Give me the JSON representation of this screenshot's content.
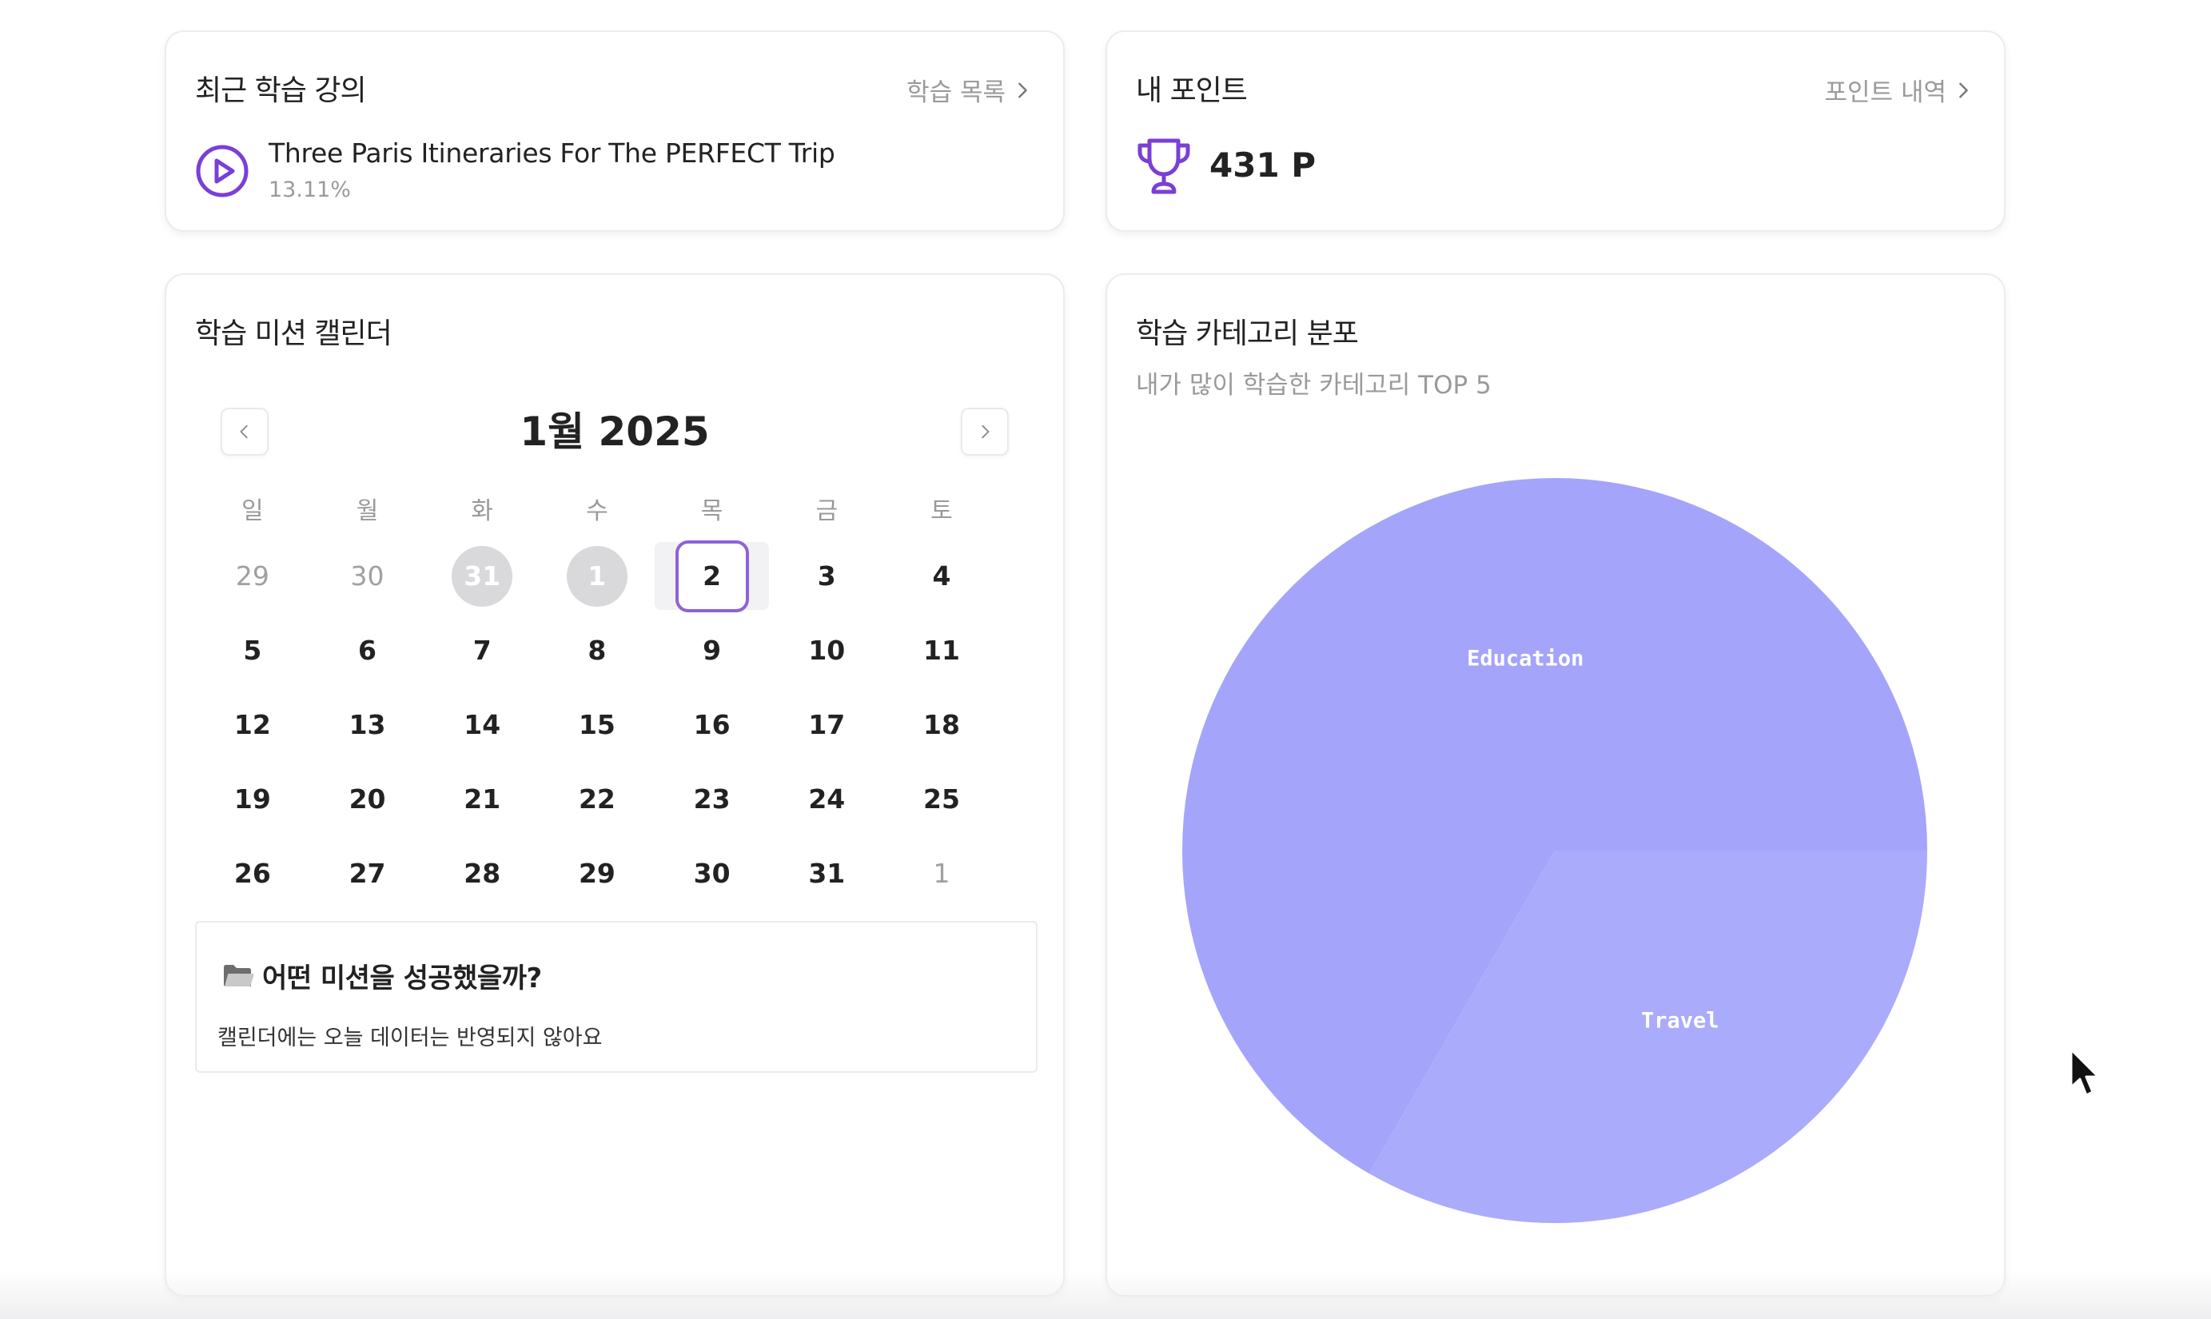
{
  "recent": {
    "title": "최근 학습 강의",
    "link_label": "학습 목록",
    "course_title": "Three Paris Itineraries For The PERFECT Trip",
    "course_progress": "13.11%"
  },
  "points": {
    "title": "내 포인트",
    "link_label": "포인트 내역",
    "value": "431 P"
  },
  "calendar": {
    "title": "학습 미션 캘린더",
    "month_label": "1월 2025",
    "weekdays": [
      "일",
      "월",
      "화",
      "수",
      "목",
      "금",
      "토"
    ],
    "weeks": [
      [
        {
          "d": "29",
          "s": "muted"
        },
        {
          "d": "30",
          "s": "muted"
        },
        {
          "d": "31",
          "s": "done"
        },
        {
          "d": "1",
          "s": "done"
        },
        {
          "d": "2",
          "s": "today"
        },
        {
          "d": "3",
          "s": ""
        },
        {
          "d": "4",
          "s": ""
        }
      ],
      [
        {
          "d": "5",
          "s": ""
        },
        {
          "d": "6",
          "s": ""
        },
        {
          "d": "7",
          "s": ""
        },
        {
          "d": "8",
          "s": ""
        },
        {
          "d": "9",
          "s": ""
        },
        {
          "d": "10",
          "s": ""
        },
        {
          "d": "11",
          "s": ""
        }
      ],
      [
        {
          "d": "12",
          "s": ""
        },
        {
          "d": "13",
          "s": ""
        },
        {
          "d": "14",
          "s": ""
        },
        {
          "d": "15",
          "s": ""
        },
        {
          "d": "16",
          "s": ""
        },
        {
          "d": "17",
          "s": ""
        },
        {
          "d": "18",
          "s": ""
        }
      ],
      [
        {
          "d": "19",
          "s": ""
        },
        {
          "d": "20",
          "s": ""
        },
        {
          "d": "21",
          "s": ""
        },
        {
          "d": "22",
          "s": ""
        },
        {
          "d": "23",
          "s": ""
        },
        {
          "d": "24",
          "s": ""
        },
        {
          "d": "25",
          "s": ""
        }
      ],
      [
        {
          "d": "26",
          "s": ""
        },
        {
          "d": "27",
          "s": ""
        },
        {
          "d": "28",
          "s": ""
        },
        {
          "d": "29",
          "s": ""
        },
        {
          "d": "30",
          "s": ""
        },
        {
          "d": "31",
          "s": ""
        },
        {
          "d": "1",
          "s": "muted"
        }
      ]
    ],
    "mission_title": "어떤 미션을 성공했을까?",
    "mission_desc": "캘린더에는 오늘 데이터는 반영되지 않아요"
  },
  "category": {
    "title": "학습 카테고리 분포",
    "subtitle": "내가 많이 학습한 카테고리 TOP 5"
  },
  "chart_data": {
    "type": "pie",
    "categories": [
      "Education",
      "Travel"
    ],
    "values": [
      66.7,
      33.3
    ],
    "colors": [
      "#a4a4fb",
      "#ababfc"
    ]
  },
  "colors": {
    "accent": "#7a3fd6",
    "today_border": "#8d63d8",
    "done_fill": "#d9d9dc"
  },
  "icons": {
    "play": "play-circle-icon",
    "trophy": "trophy-icon",
    "folder": "open-folder-icon",
    "chevron": "chevron-right-icon"
  }
}
